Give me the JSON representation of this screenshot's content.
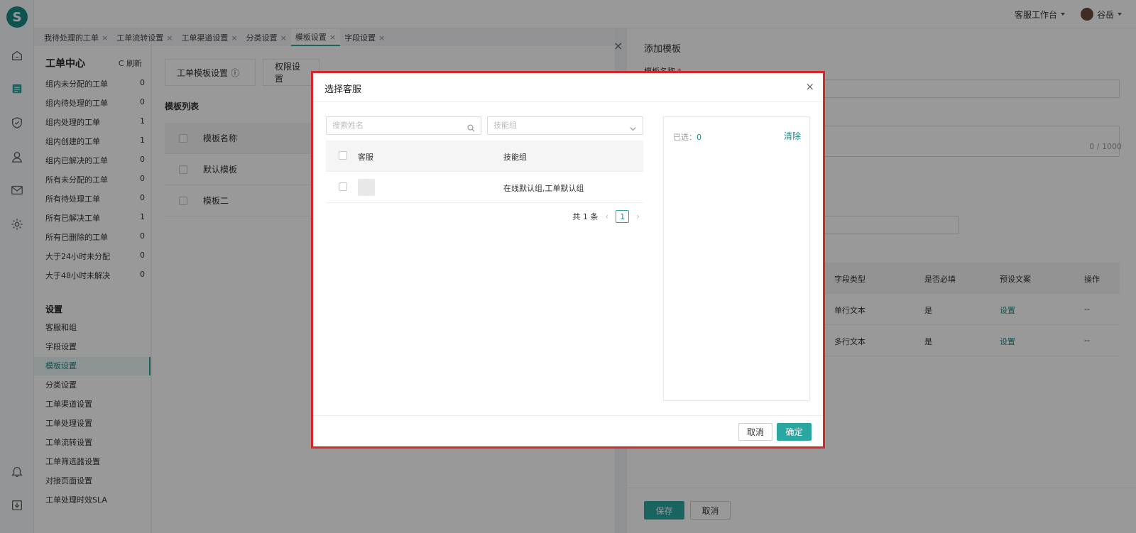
{
  "app": {
    "logo": "S"
  },
  "topbar": {
    "workspace": "客服工作台",
    "user": "谷岳"
  },
  "tabs": [
    {
      "label": "我待处理的工单"
    },
    {
      "label": "工单流转设置"
    },
    {
      "label": "工单渠道设置"
    },
    {
      "label": "分类设置"
    },
    {
      "label": "模板设置",
      "active": true
    },
    {
      "label": "字段设置"
    }
  ],
  "tab_close": "×",
  "sidebar": {
    "title": "工单中心",
    "refresh": "C 刷新",
    "counts": [
      {
        "label": "组内未分配的工单",
        "count": "0"
      },
      {
        "label": "组内待处理的工单",
        "count": "0"
      },
      {
        "label": "组内处理的工单",
        "count": "1"
      },
      {
        "label": "组内创建的工单",
        "count": "1"
      },
      {
        "label": "组内已解决的工单",
        "count": "0"
      },
      {
        "label": "所有未分配的工单",
        "count": "0"
      },
      {
        "label": "所有待处理工单",
        "count": "0"
      },
      {
        "label": "所有已解决工单",
        "count": "1"
      },
      {
        "label": "所有已删除的工单",
        "count": "0"
      },
      {
        "label": "大于24小时未分配",
        "count": "0"
      },
      {
        "label": "大于48小时未解决",
        "count": "0"
      }
    ],
    "settings_title": "设置",
    "settings": [
      {
        "label": "客服和组"
      },
      {
        "label": "字段设置"
      },
      {
        "label": "模板设置",
        "active": true
      },
      {
        "label": "分类设置"
      },
      {
        "label": "工单渠道设置"
      },
      {
        "label": "工单处理设置"
      },
      {
        "label": "工单流转设置"
      },
      {
        "label": "工单筛选器设置"
      },
      {
        "label": "对接页面设置"
      },
      {
        "label": "工单处理时效SLA"
      }
    ]
  },
  "center": {
    "tab1": "工单模板设置",
    "tab1_info": "ⓘ",
    "tab2": "权限设置",
    "list_title": "模板列表",
    "header": "模板名称",
    "rows": [
      "默认模板",
      "模板二"
    ]
  },
  "drawer": {
    "close": "×",
    "title": "添加模板",
    "name_label": "模板名称",
    "required_mark": "*",
    "count": "0 / 1000",
    "columns": [
      "字段类型",
      "是否必填",
      "预设文案",
      "操作"
    ],
    "rows": [
      {
        "type": "单行文本",
        "required": "是",
        "preset": "设置",
        "op": "--"
      },
      {
        "type": "多行文本",
        "required": "是",
        "preset": "设置",
        "op": "--"
      }
    ],
    "save": "保存",
    "cancel": "取消"
  },
  "modal": {
    "title": "选择客服",
    "close": "×",
    "search_placeholder": "搜索姓名",
    "group_placeholder": "技能组",
    "columns": {
      "agent": "客服",
      "group": "技能组"
    },
    "rows": [
      {
        "agent": "",
        "group": "在线默认组,工单默认组"
      }
    ],
    "pager": {
      "total": "共 1 条",
      "page": "1",
      "prev": "‹",
      "next": "›"
    },
    "selected_label": "已选：",
    "selected_count": "0",
    "clear": "清除",
    "cancel": "取消",
    "confirm": "确定"
  },
  "colors": {
    "accent": "#2aa7a0",
    "highlight_border": "#d9262b"
  }
}
